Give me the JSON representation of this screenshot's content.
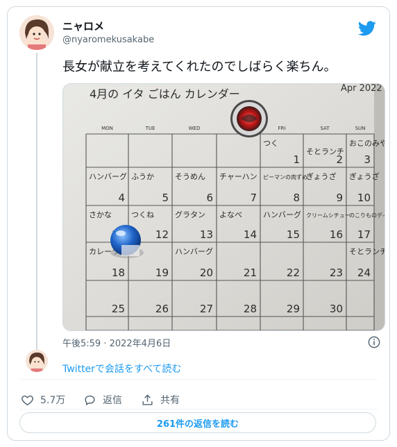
{
  "author": {
    "display_name": "ニャロメ",
    "handle": "@nyaromekusakabe"
  },
  "tweet": {
    "text": "長女が献立を考えてくれたのでしばらく楽ちん。",
    "timestamp": "午後5:59 · 2022年4月6日"
  },
  "media": {
    "calendar_header": "4月の イタ ごはん カレンダー",
    "corner_text": "Apr 2022",
    "weekdays": [
      "MON",
      "TUE",
      "WED",
      "THU",
      "FRI",
      "SAT",
      "SUN"
    ],
    "dates": [
      "1",
      "2",
      "3",
      "4",
      "5",
      "6",
      "7",
      "8",
      "9",
      "10",
      "11",
      "12",
      "13",
      "14",
      "15",
      "16",
      "17",
      "18",
      "19",
      "20",
      "21",
      "22",
      "23",
      "24",
      "25",
      "26",
      "27",
      "28",
      "29",
      "30"
    ],
    "menu": [
      "つく",
      "そとランチ",
      "おこのみやき",
      "ハンバーグ",
      "ふうか",
      "そうめん",
      "チャーハン",
      "ピーマンの肉ずめ",
      "ぎょうざ",
      "ぎょうざ",
      "さかな",
      "つくね",
      "グラタン",
      "よなべ",
      "ハンバーグ",
      "クリームシチュー",
      "のこりものディナー",
      "カレーライス",
      "ハンバーグ",
      "そとランチ"
    ]
  },
  "thread": {
    "read_conversation": "Twitterで会話をすべて読む"
  },
  "actions": {
    "likes": "5.7万",
    "reply_label": "返信",
    "share_label": "共有"
  },
  "replies_button": "261件の返信を読む",
  "colors": {
    "accent": "#1d9bf0",
    "text_secondary": "#536471",
    "border": "#cfd9de"
  }
}
